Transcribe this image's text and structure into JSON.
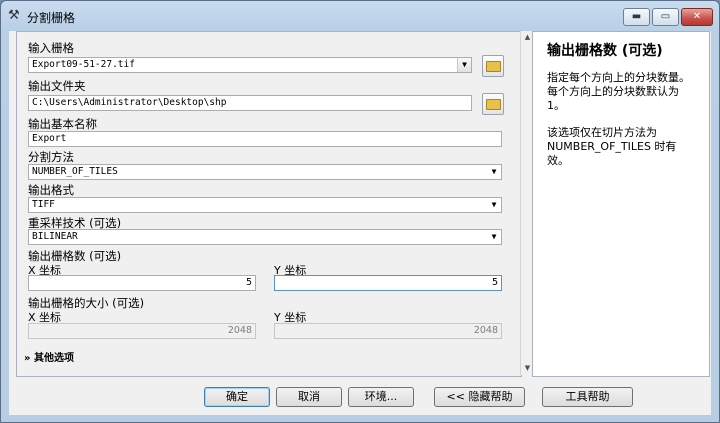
{
  "window": {
    "title": "分割栅格",
    "minimize": "▬",
    "maximize": "▭",
    "close": "✕"
  },
  "form": {
    "input_raster": {
      "label": "输入栅格",
      "value": "Export09-51-27.tif"
    },
    "output_folder": {
      "label": "输出文件夹",
      "value": "C:\\Users\\Administrator\\Desktop\\shp"
    },
    "base_name": {
      "label": "输出基本名称",
      "value": "Export"
    },
    "split_method": {
      "label": "分割方法",
      "value": "NUMBER_OF_TILES"
    },
    "output_format": {
      "label": "输出格式",
      "value": "TIFF"
    },
    "resampling": {
      "label": "重采样技术 (可选)",
      "value": "BILINEAR"
    },
    "num_rasters": {
      "label": "输出栅格数 (可选)",
      "x_label": "X 坐标",
      "x_value": "5",
      "y_label": "Y 坐标",
      "y_value": "5"
    },
    "tile_size": {
      "label": "输出栅格的大小 (可选)",
      "x_label": "X 坐标",
      "x_value": "2048",
      "y_label": "Y 坐标",
      "y_value": "2048"
    },
    "more_options": "其他选项"
  },
  "help": {
    "title": "输出栅格数 (可选)",
    "para1": "指定每个方向上的分块数量。每个方向上的分块数默认为 1。",
    "para2": "该选项仅在切片方法为 NUMBER_OF_TILES 时有效。"
  },
  "buttons": {
    "ok": "确定",
    "cancel": "取消",
    "env": "环境...",
    "hide_help": "<< 隐藏帮助",
    "tool_help": "工具帮助"
  }
}
